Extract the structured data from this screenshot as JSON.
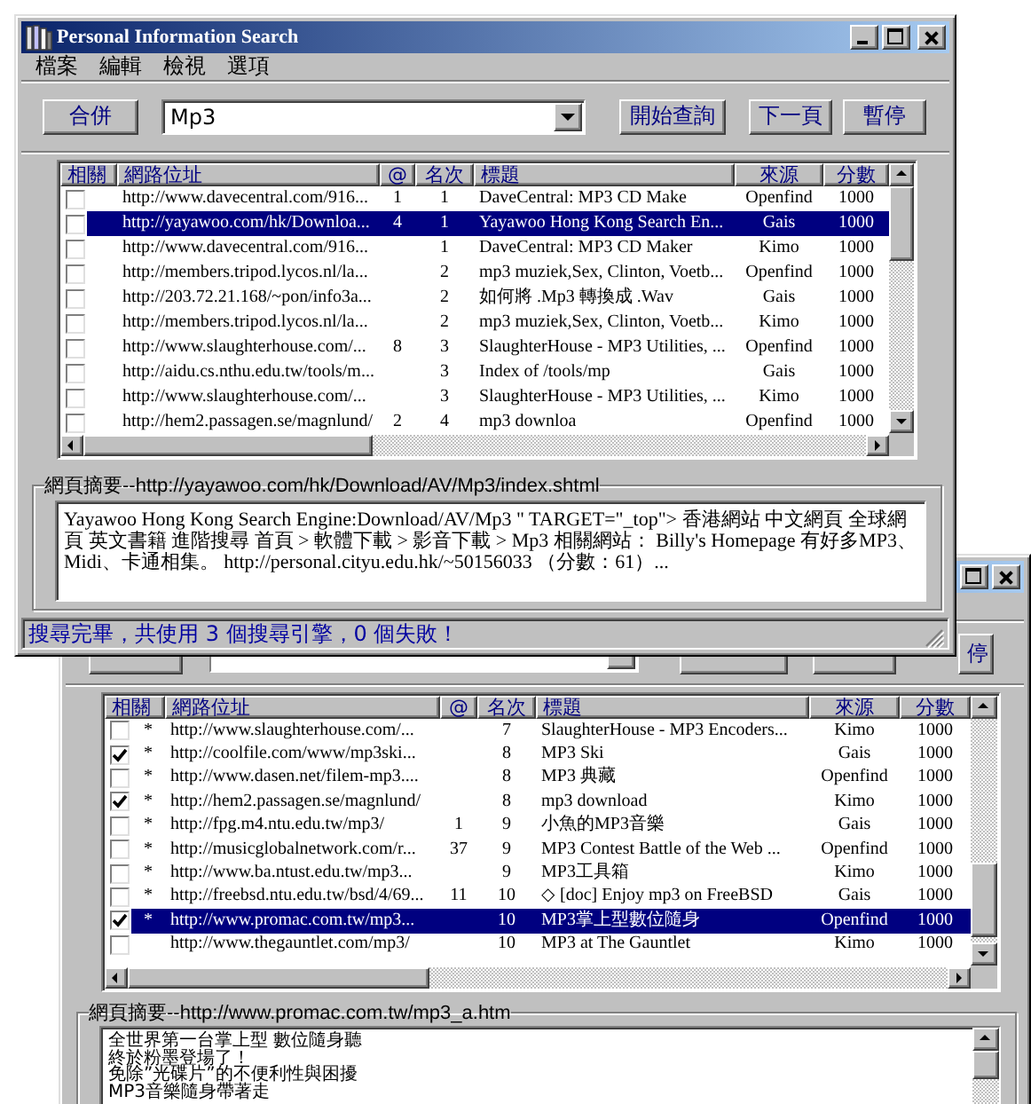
{
  "front_window": {
    "title": "Personal Information Search",
    "menu": [
      "檔案",
      "編輯",
      "檢視",
      "選項"
    ],
    "merge_button": "合併",
    "query": {
      "value": "Mp3"
    },
    "buttons": [
      "開始查詢",
      "下一頁",
      "暫停"
    ],
    "columns": [
      "相關",
      "網路位址",
      "@",
      "名次",
      "標題",
      "來源",
      "分數"
    ],
    "rows": [
      {
        "checked": false,
        "selected": false,
        "url": "http://www.davecentral.com/916...",
        "at": "1",
        "rank": "1",
        "title": "DaveCentral: MP3 CD Make",
        "source": "Openfind",
        "score": "1000"
      },
      {
        "checked": false,
        "selected": true,
        "url": "http://yayawoo.com/hk/Downloa...",
        "at": "4",
        "rank": "1",
        "title": "Yayawoo Hong Kong Search En...",
        "source": "Gais",
        "score": "1000"
      },
      {
        "checked": false,
        "selected": false,
        "url": "http://www.davecentral.com/916...",
        "rank": "1",
        "title": "DaveCentral: MP3 CD Maker",
        "source": "Kimo",
        "score": "1000"
      },
      {
        "checked": false,
        "selected": false,
        "url": "http://members.tripod.lycos.nl/la...",
        "rank": "2",
        "title": "mp3 muziek,Sex, Clinton, Voetb...",
        "source": "Openfind",
        "score": "1000"
      },
      {
        "checked": false,
        "selected": false,
        "url": "http://203.72.21.168/~pon/info3a...",
        "rank": "2",
        "title": "如何將 .Mp3 轉換成 .Wav",
        "source": "Gais",
        "score": "1000"
      },
      {
        "checked": false,
        "selected": false,
        "url": "http://members.tripod.lycos.nl/la...",
        "rank": "2",
        "title": "mp3 muziek,Sex, Clinton, Voetb...",
        "source": "Kimo",
        "score": "1000"
      },
      {
        "checked": false,
        "selected": false,
        "url": "http://www.slaughterhouse.com/...",
        "at": "8",
        "rank": "3",
        "title": "SlaughterHouse - MP3 Utilities, ...",
        "source": "Openfind",
        "score": "1000"
      },
      {
        "checked": false,
        "selected": false,
        "url": "http://aidu.cs.nthu.edu.tw/tools/m...",
        "rank": "3",
        "title": "Index of /tools/mp",
        "source": "Gais",
        "score": "1000"
      },
      {
        "checked": false,
        "selected": false,
        "url": "http://www.slaughterhouse.com/...",
        "rank": "3",
        "title": "SlaughterHouse - MP3 Utilities, ...",
        "source": "Kimo",
        "score": "1000"
      },
      {
        "checked": false,
        "selected": false,
        "url": "http://hem2.passagen.se/magnlund/",
        "at": "2",
        "rank": "4",
        "title": "mp3 downloa",
        "source": "Openfind",
        "score": "1000"
      }
    ],
    "summary": {
      "label": "網頁摘要",
      "url": "--http://yayawoo.com/hk/Download/AV/Mp3/index.shtml",
      "text": "Yayawoo Hong Kong Search Engine:Download/AV/Mp3 \" TARGET=\"_top\"> 香港網站 中文網頁 全球網頁 英文書籍 進階搜尋 首頁 > 軟體下載 > 影音下載 > Mp3 相關網站： Billy's Homepage 有好多MP3、Midi、卡通相集。 http://personal.cityu.edu.hk/~50156033 （分數：61）..."
    },
    "status_bar": "搜尋完畢，共使用 3 個搜尋引擎，0 個失敗！"
  },
  "back_window": {
    "partial_button_label": "停",
    "columns": [
      "相關",
      "網路位址",
      "@",
      "名次",
      "標題",
      "來源",
      "分數"
    ],
    "rows": [
      {
        "checked": false,
        "selected": false,
        "mark": "*",
        "url": "http://www.slaughterhouse.com/...",
        "rank": "7",
        "title": "SlaughterHouse - MP3 Encoders...",
        "source": "Kimo",
        "score": "1000"
      },
      {
        "checked": true,
        "selected": false,
        "mark": "*",
        "url": "http://coolfile.com/www/mp3ski...",
        "rank": "8",
        "title": "MP3 Ski",
        "source": "Gais",
        "score": "1000"
      },
      {
        "checked": false,
        "selected": false,
        "mark": "*",
        "url": "http://www.dasen.net/filem-mp3....",
        "rank": "8",
        "title": "MP3 典藏",
        "source": "Openfind",
        "score": "1000"
      },
      {
        "checked": true,
        "selected": false,
        "mark": "*",
        "url": "http://hem2.passagen.se/magnlund/",
        "rank": "8",
        "title": "mp3 download",
        "source": "Kimo",
        "score": "1000"
      },
      {
        "checked": false,
        "selected": false,
        "mark": "*",
        "url": "http://fpg.m4.ntu.edu.tw/mp3/",
        "at": "1",
        "rank": "9",
        "title": "小魚的MP3音樂",
        "source": "Gais",
        "score": "1000"
      },
      {
        "checked": false,
        "selected": false,
        "mark": "*",
        "url": "http://musicglobalnetwork.com/r...",
        "at": "37",
        "rank": "9",
        "title": "MP3 Contest Battle of the Web ...",
        "source": "Openfind",
        "score": "1000"
      },
      {
        "checked": false,
        "selected": false,
        "mark": "*",
        "url": "http://www.ba.ntust.edu.tw/mp3...",
        "rank": "9",
        "title": "MP3工具箱",
        "source": "Kimo",
        "score": "1000"
      },
      {
        "checked": false,
        "selected": false,
        "mark": "*",
        "url": "http://freebsd.ntu.edu.tw/bsd/4/69...",
        "at": "11",
        "rank": "10",
        "title": "◇ [doc] Enjoy mp3 on FreeBSD",
        "source": "Gais",
        "score": "1000"
      },
      {
        "checked": true,
        "selected": true,
        "mark": "*",
        "url": "http://www.promac.com.tw/mp3...",
        "rank": "10",
        "title": "MP3掌上型數位隨身",
        "source": "Openfind",
        "score": "1000"
      },
      {
        "checked": false,
        "selected": false,
        "url": "http://www.thegauntlet.com/mp3/",
        "rank": "10",
        "title": "MP3 at The Gauntlet",
        "source": "Kimo",
        "score": "1000"
      }
    ],
    "summary": {
      "label": "網頁摘要",
      "url": "--http://www.promac.com.tw/mp3_a.htm",
      "lines": [
        "全世界第一台掌上型 數位隨身聽",
        "終於粉墨登場了！",
        "免除”光碟片”的不便利性與困擾",
        "MP3音樂隨身帶著走"
      ]
    }
  }
}
